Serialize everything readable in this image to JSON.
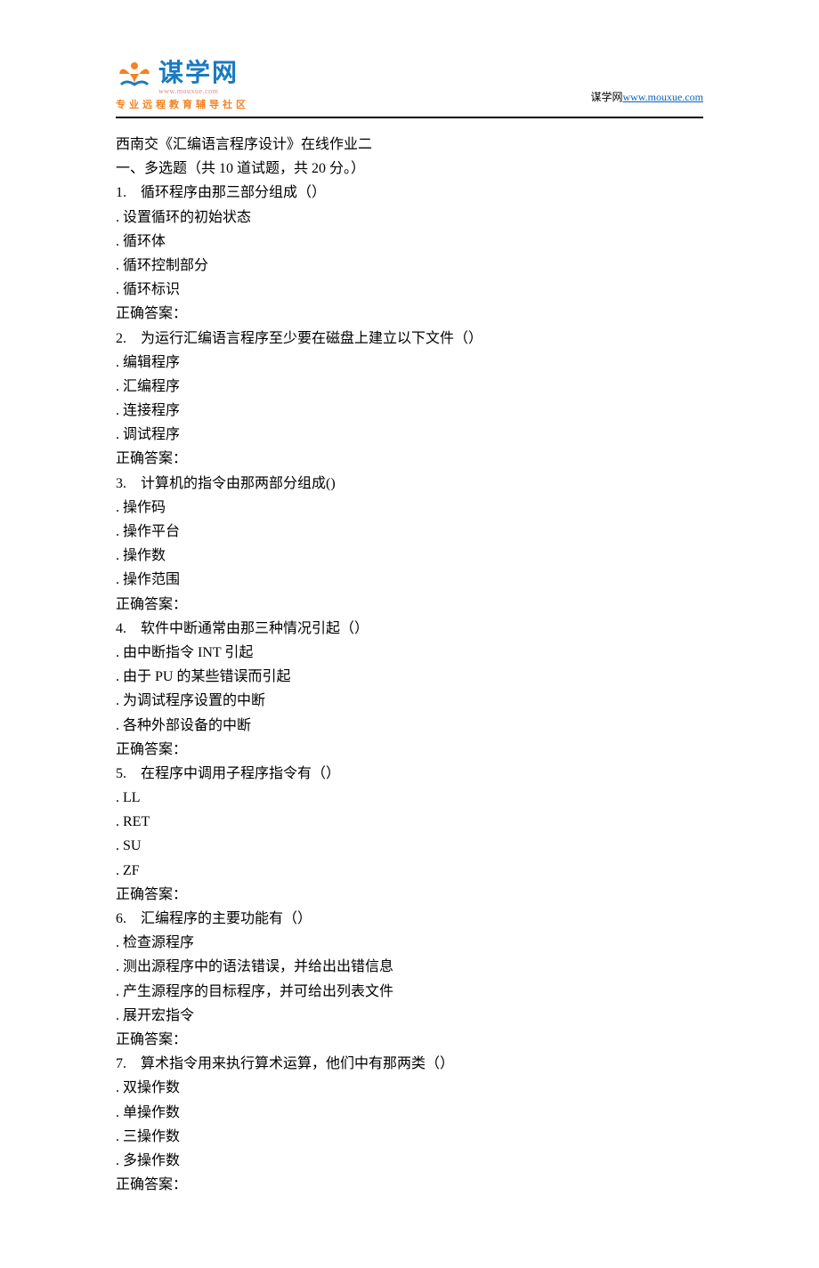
{
  "header": {
    "logo_cn": "谋学网",
    "logo_url": "www.mouxue.com",
    "logo_sub": "专业远程教育辅导社区",
    "right_prefix": "谋学网",
    "right_link": "www.mouxue.com"
  },
  "doc": {
    "title": "西南交《汇编语言程序设计》在线作业二",
    "section": "一、多选题（共 10 道试题，共 20 分。）",
    "answer_label": "正确答案：",
    "questions": [
      {
        "num": "1.",
        "text": "循环程序由那三部分组成（）",
        "opts": [
          "设置循环的初始状态",
          "循环体",
          "循环控制部分",
          "循环标识"
        ]
      },
      {
        "num": "2.",
        "text": "为运行汇编语言程序至少要在磁盘上建立以下文件（）",
        "opts": [
          "编辑程序",
          "汇编程序",
          "连接程序",
          "调试程序"
        ]
      },
      {
        "num": "3.",
        "text": "计算机的指令由那两部分组成()",
        "opts": [
          "操作码",
          "操作平台",
          "操作数",
          "操作范围"
        ]
      },
      {
        "num": "4.",
        "text": "软件中断通常由那三种情况引起（）",
        "opts": [
          "由中断指令 INT 引起",
          "由于 PU 的某些错误而引起",
          "为调试程序设置的中断",
          "各种外部设备的中断"
        ]
      },
      {
        "num": "5.",
        "text": "在程序中调用子程序指令有（）",
        "opts": [
          "LL",
          "RET",
          "SU",
          "ZF"
        ]
      },
      {
        "num": "6.",
        "text": "汇编程序的主要功能有（）",
        "opts": [
          "检查源程序",
          "测出源程序中的语法错误，并给出出错信息",
          "产生源程序的目标程序，并可给出列表文件",
          "展开宏指令"
        ]
      },
      {
        "num": "7.",
        "text": "算术指令用来执行算术运算，他们中有那两类（）",
        "opts": [
          "双操作数",
          "单操作数",
          "三操作数",
          "多操作数"
        ]
      }
    ]
  }
}
